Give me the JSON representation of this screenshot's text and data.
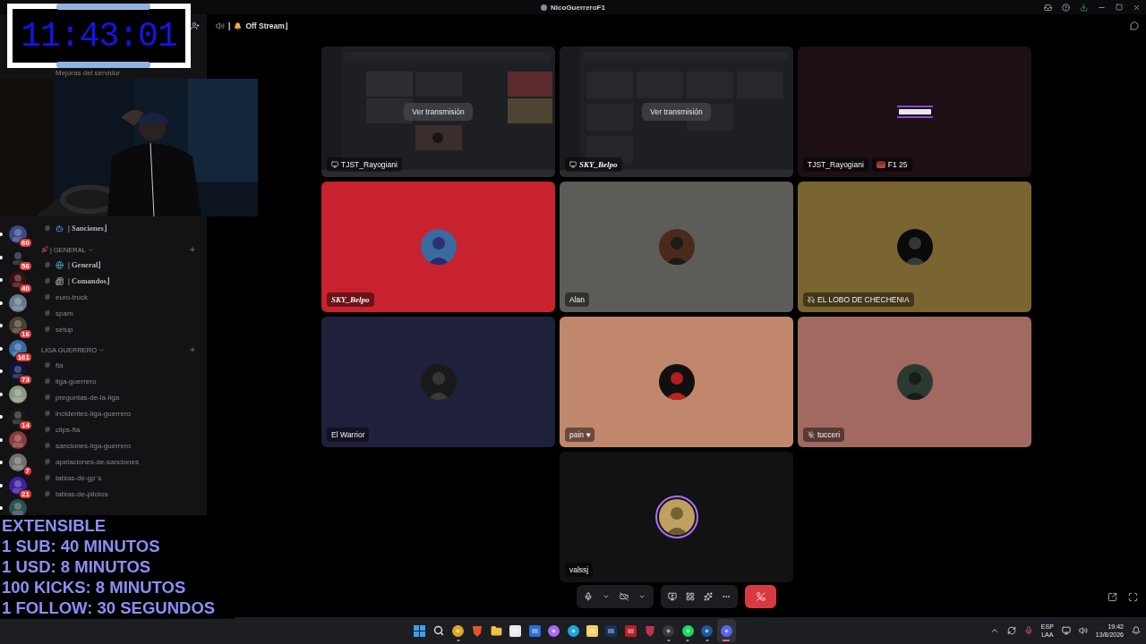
{
  "title_bar": {
    "title": "NicoGuerreroF1"
  },
  "timer_overlay": {
    "time": "11:43:01"
  },
  "promo_lines": [
    "EXTENSIBLE",
    "1 SUB: 40 MINUTOS",
    "1 USD: 8 MINUTOS",
    "100 KICKS: 8 MINUTOS",
    "1 FOLLOW: 30 SEGUNDOS"
  ],
  "sidebar": {
    "menu_items": [
      {
        "label": "Mejoras del servidor"
      }
    ],
    "servers": [
      {
        "badge": "60",
        "unread": true
      },
      {
        "badge": "56",
        "unread": true
      },
      {
        "badge": "40",
        "unread": true
      },
      {
        "unread": true
      },
      {
        "badge": "16",
        "unread": true
      },
      {
        "badge": "161",
        "unread": true
      },
      {
        "badge": "73",
        "unread": true
      },
      {
        "unread": true
      },
      {
        "badge": "14",
        "unread": true
      },
      {
        "unread": true
      },
      {
        "badge": "7",
        "unread": true
      },
      {
        "badge": "21",
        "unread": true
      },
      {
        "unread": true
      }
    ],
    "channel_groups": [
      {
        "channels": [
          {
            "name": "| Sanciones⌋",
            "kind": "robot",
            "fancy": true
          }
        ]
      },
      {
        "name": "| GENERAL",
        "kind": "rocket",
        "channels": [
          {
            "name": "| General⌋",
            "kind": "globe",
            "fancy": true
          },
          {
            "name": "| Comandos⌋",
            "kind": "news",
            "fancy": true
          },
          {
            "name": "euro-truck",
            "kind": "plain",
            "fancy": false
          },
          {
            "name": "spam",
            "kind": "plain",
            "fancy": false
          },
          {
            "name": "setup",
            "kind": "plain",
            "fancy": false
          }
        ]
      },
      {
        "name": "LIGA GUERRERO",
        "kind": "plain",
        "channels": [
          {
            "name": "fia",
            "kind": "plain",
            "fancy": false
          },
          {
            "name": "liga-guerrero",
            "kind": "plain",
            "fancy": false
          },
          {
            "name": "preguntas-de-la-liga",
            "kind": "plain",
            "fancy": false
          },
          {
            "name": "incidentes-liga-guerrero",
            "kind": "plain",
            "fancy": false
          },
          {
            "name": "clips-fia",
            "kind": "plain",
            "fancy": false
          },
          {
            "name": "sanciones-liga-guerrero",
            "kind": "plain",
            "fancy": false
          },
          {
            "name": "apelaciones-de-sanciones",
            "kind": "plain",
            "fancy": false
          },
          {
            "name": "tablas-de-gp´s",
            "kind": "plain",
            "fancy": false
          },
          {
            "name": "tablas-de-pilotos",
            "kind": "plain",
            "fancy": false
          }
        ]
      }
    ]
  },
  "channel_header": {
    "prefix": "|",
    "name": "Off Stream⌋"
  },
  "tiles": [
    {
      "kind": "stream",
      "name": "TJST_Rayogiani",
      "fancy_name": false,
      "sharing": true,
      "deafened": false,
      "muted": false,
      "button": "Ver transmisión"
    },
    {
      "kind": "stream",
      "name": "SKY_Belpo",
      "fancy_name": true,
      "sharing": true,
      "deafened": false,
      "muted": false,
      "button": "Ver transmisión"
    },
    {
      "kind": "card",
      "name": "TJST_Rayogiani",
      "fancy_name": false,
      "sharing": false,
      "deafened": false,
      "muted": false,
      "color": "#1c0f15",
      "activity": "F1 25"
    },
    {
      "kind": "avatar",
      "name": "SKY_Belpo",
      "fancy_name": true,
      "sharing": false,
      "deafened": false,
      "muted": false,
      "speaking": false,
      "color": "#c8222e"
    },
    {
      "kind": "avatar",
      "name": "Alan",
      "fancy_name": false,
      "sharing": false,
      "deafened": false,
      "muted": false,
      "speaking": false,
      "color": "#5d5c58"
    },
    {
      "kind": "avatar",
      "name": "EL LOBO DE CHECHENIA",
      "fancy_name": false,
      "sharing": false,
      "deafened": true,
      "muted": false,
      "speaking": false,
      "color": "#7a6530"
    },
    {
      "kind": "avatar",
      "name": "El Warrior",
      "fancy_name": false,
      "sharing": false,
      "deafened": false,
      "muted": false,
      "speaking": false,
      "color": "#1f203b"
    },
    {
      "kind": "avatar",
      "name": "pain ♥",
      "fancy_name": false,
      "sharing": false,
      "deafened": false,
      "muted": false,
      "speaking": false,
      "color": "#c1876c"
    },
    {
      "kind": "avatar",
      "name": "tucceri",
      "fancy_name": false,
      "sharing": false,
      "deafened": false,
      "muted": true,
      "speaking": false,
      "color": "#a1695f"
    },
    {
      "kind": "avatar",
      "name": "valssj",
      "fancy_name": false,
      "sharing": false,
      "deafened": false,
      "muted": false,
      "speaking": true,
      "color": "#121213"
    }
  ],
  "controls": {
    "camera_on": false
  },
  "taskbar": {
    "apps": [
      {
        "kind": "start",
        "color": "#3aa0f0",
        "running": false,
        "active": false
      },
      {
        "kind": "search",
        "color": "#dddddd",
        "running": false,
        "active": false
      },
      {
        "kind": "round",
        "color": "#e0a528",
        "running": true,
        "active": false
      },
      {
        "kind": "shield",
        "color": "#e2552c",
        "running": false,
        "active": false
      },
      {
        "kind": "folder",
        "color": "#f2c541",
        "running": false,
        "active": false
      },
      {
        "kind": "square",
        "color": "#e8e8e8",
        "running": false,
        "active": false
      },
      {
        "kind": "square",
        "color": "#2b6fd8",
        "running": false,
        "active": false
      },
      {
        "kind": "round",
        "color": "#a66cf0",
        "running": false,
        "active": false
      },
      {
        "kind": "round",
        "color": "#1fa5d8",
        "running": false,
        "active": false
      },
      {
        "kind": "square",
        "color": "#f0d060",
        "running": false,
        "active": false
      },
      {
        "kind": "square",
        "color": "#12345a",
        "running": false,
        "active": false
      },
      {
        "kind": "square",
        "color": "#b8202a",
        "running": false,
        "active": false
      },
      {
        "kind": "shield",
        "color": "#c03050",
        "running": false,
        "active": false
      },
      {
        "kind": "round",
        "color": "#3a3a3a",
        "running": true,
        "active": false
      },
      {
        "kind": "round",
        "color": "#1ed760",
        "running": true,
        "active": false
      },
      {
        "kind": "round",
        "color": "#1b5aa0",
        "running": true,
        "active": false
      },
      {
        "kind": "round",
        "color": "#5865f2",
        "running": true,
        "active": true
      }
    ],
    "tray": {
      "language": "ESP",
      "layout": "LAA",
      "time": "19:42",
      "date": "13/8/2026"
    }
  }
}
